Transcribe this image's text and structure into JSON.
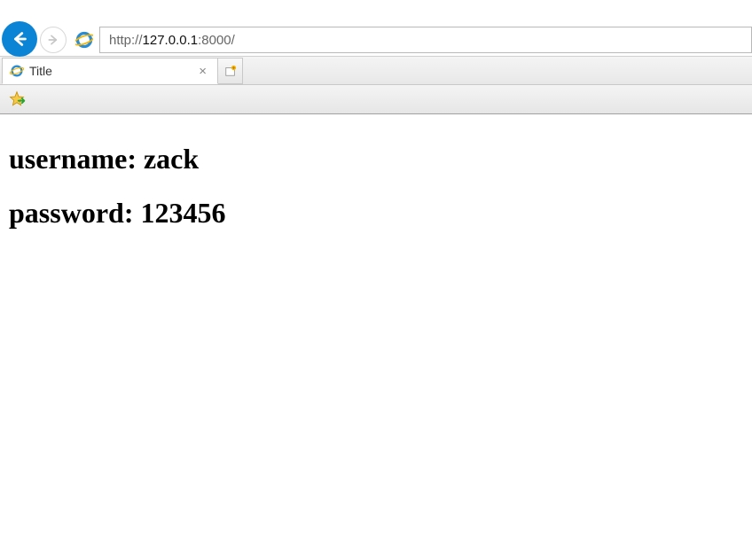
{
  "address": {
    "prefix": "http://",
    "host": "127.0.0.1",
    "suffix": ":8000/"
  },
  "tab": {
    "title": "Title",
    "close": "×"
  },
  "content": {
    "line1": "username: zack",
    "line2": "password: 123456"
  }
}
